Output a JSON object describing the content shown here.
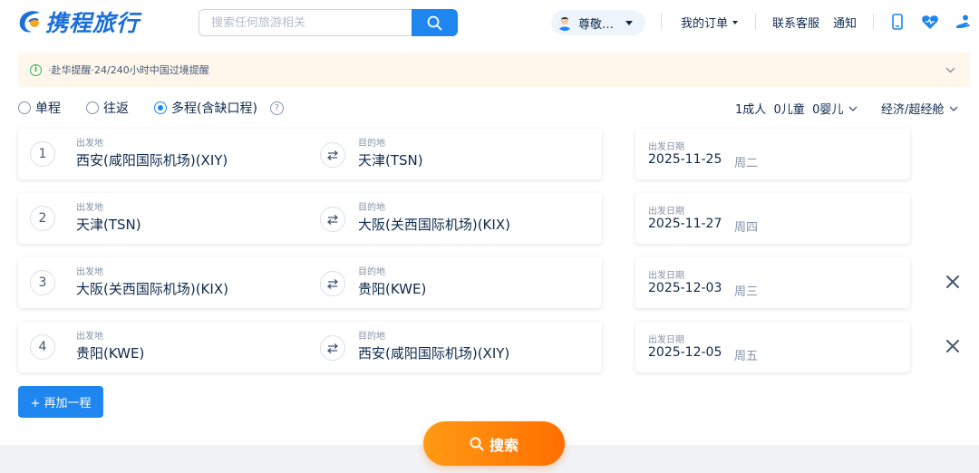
{
  "header": {
    "logo_text": "携程旅行",
    "search_placeholder": "搜索任何旅游相关",
    "user_name": "尊敬…",
    "my_orders": "我的订单",
    "customer_service": "联系客服",
    "notifications": "通知",
    "icons": [
      "mobile-icon",
      "heart-icon",
      "cs-icon"
    ]
  },
  "notice": {
    "text": "·赴华提醒·24/240小时中国过境提醒"
  },
  "trip_types": [
    {
      "label": "单程",
      "checked": false
    },
    {
      "label": "往返",
      "checked": false
    },
    {
      "label": "多程(含缺口程)",
      "checked": true
    }
  ],
  "passengers": "1成人  0儿童  0婴儿",
  "cabin": "经济/超经舱",
  "labels": {
    "origin": "出发地",
    "destination": "目的地",
    "depart_date": "出发日期"
  },
  "segments": [
    {
      "num": "1",
      "origin": "西安(咸阳国际机场)(XIY)",
      "destination": "天津(TSN)",
      "date": "2025-11-25",
      "weekday": "周二",
      "removable": false
    },
    {
      "num": "2",
      "origin": "天津(TSN)",
      "destination": "大阪(关西国际机场)(KIX)",
      "date": "2025-11-27",
      "weekday": "周四",
      "removable": false
    },
    {
      "num": "3",
      "origin": "大阪(关西国际机场)(KIX)",
      "destination": "贵阳(KWE)",
      "date": "2025-12-03",
      "weekday": "周三",
      "removable": true
    },
    {
      "num": "4",
      "origin": "贵阳(KWE)",
      "destination": "西安(咸阳国际机场)(XIY)",
      "date": "2025-12-05",
      "weekday": "周五",
      "removable": true
    }
  ],
  "add_segment": "+ 再加一程",
  "search_button": "搜索",
  "colors": {
    "brand_blue": "#1f86f0",
    "logo_blue": "#1a6fd9",
    "search_orange": "#ff7a00",
    "notice_bg": "#fff7ec"
  }
}
